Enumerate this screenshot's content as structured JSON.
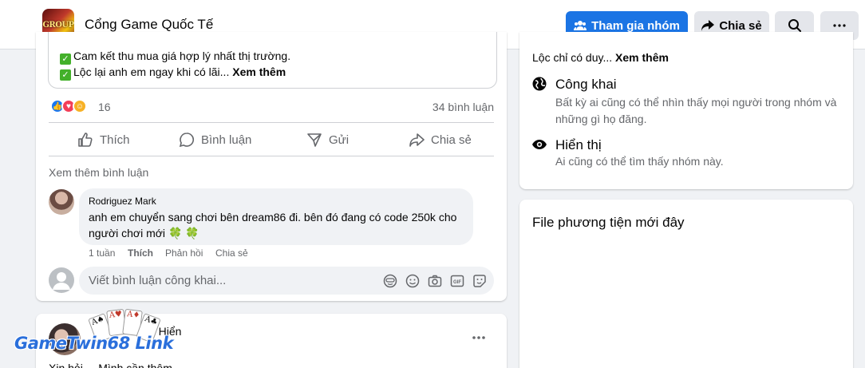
{
  "header": {
    "logo_text": "GROUP",
    "title": "Cổng Game Quốc Tế",
    "join_label": "Tham gia nhóm",
    "share_label": "Chia sẻ"
  },
  "post1": {
    "quoted_lines": [
      "Cam kết thu mua giá hợp lý nhất thị trường.",
      "Lộc lại anh em ngay khi có lãi..."
    ],
    "see_more": "Xem thêm",
    "reaction_count": "16",
    "comment_count": "34 bình luận",
    "actions": {
      "like": "Thích",
      "comment": "Bình luận",
      "send": "Gửi",
      "share": "Chia sẻ"
    },
    "more_comments": "Xem thêm bình luận",
    "comment": {
      "author": "Rodriguez Mark",
      "text": "anh em chuyển sang chơi bên dream86 đi. bên đó đang có code 250k cho người chơi mới",
      "emoji": "🍀 🍀",
      "time": "1 tuần",
      "like": "Thích",
      "reply": "Phản hồi",
      "share": "Chia sẻ"
    },
    "input_placeholder": "Viết bình luận công khai..."
  },
  "post2": {
    "author_visible": "ọc Hiển",
    "snippet": "Xin hỏi ... Mình cần thêm ..."
  },
  "watermark": {
    "text": "GameTwin68 Link",
    "card_suits": [
      "A♠",
      "A♥",
      "A♦",
      "A♣"
    ]
  },
  "about": {
    "desc_snippet": "Lộc chỉ có duy...",
    "see_more": "Xem thêm",
    "public_title": "Công khai",
    "public_desc": "Bất kỳ ai cũng có thể nhìn thấy mọi người trong nhóm và những gì họ đăng.",
    "visible_title": "Hiển thị",
    "visible_desc": "Ai cũng có thể tìm thấy nhóm này."
  },
  "media": {
    "title": "File phương tiện mới đây"
  },
  "colors": {
    "primary": "#1b74e4",
    "secondary_bg": "#e4e6eb",
    "page_bg": "#f0f2f5",
    "muted_text": "#65676b"
  }
}
